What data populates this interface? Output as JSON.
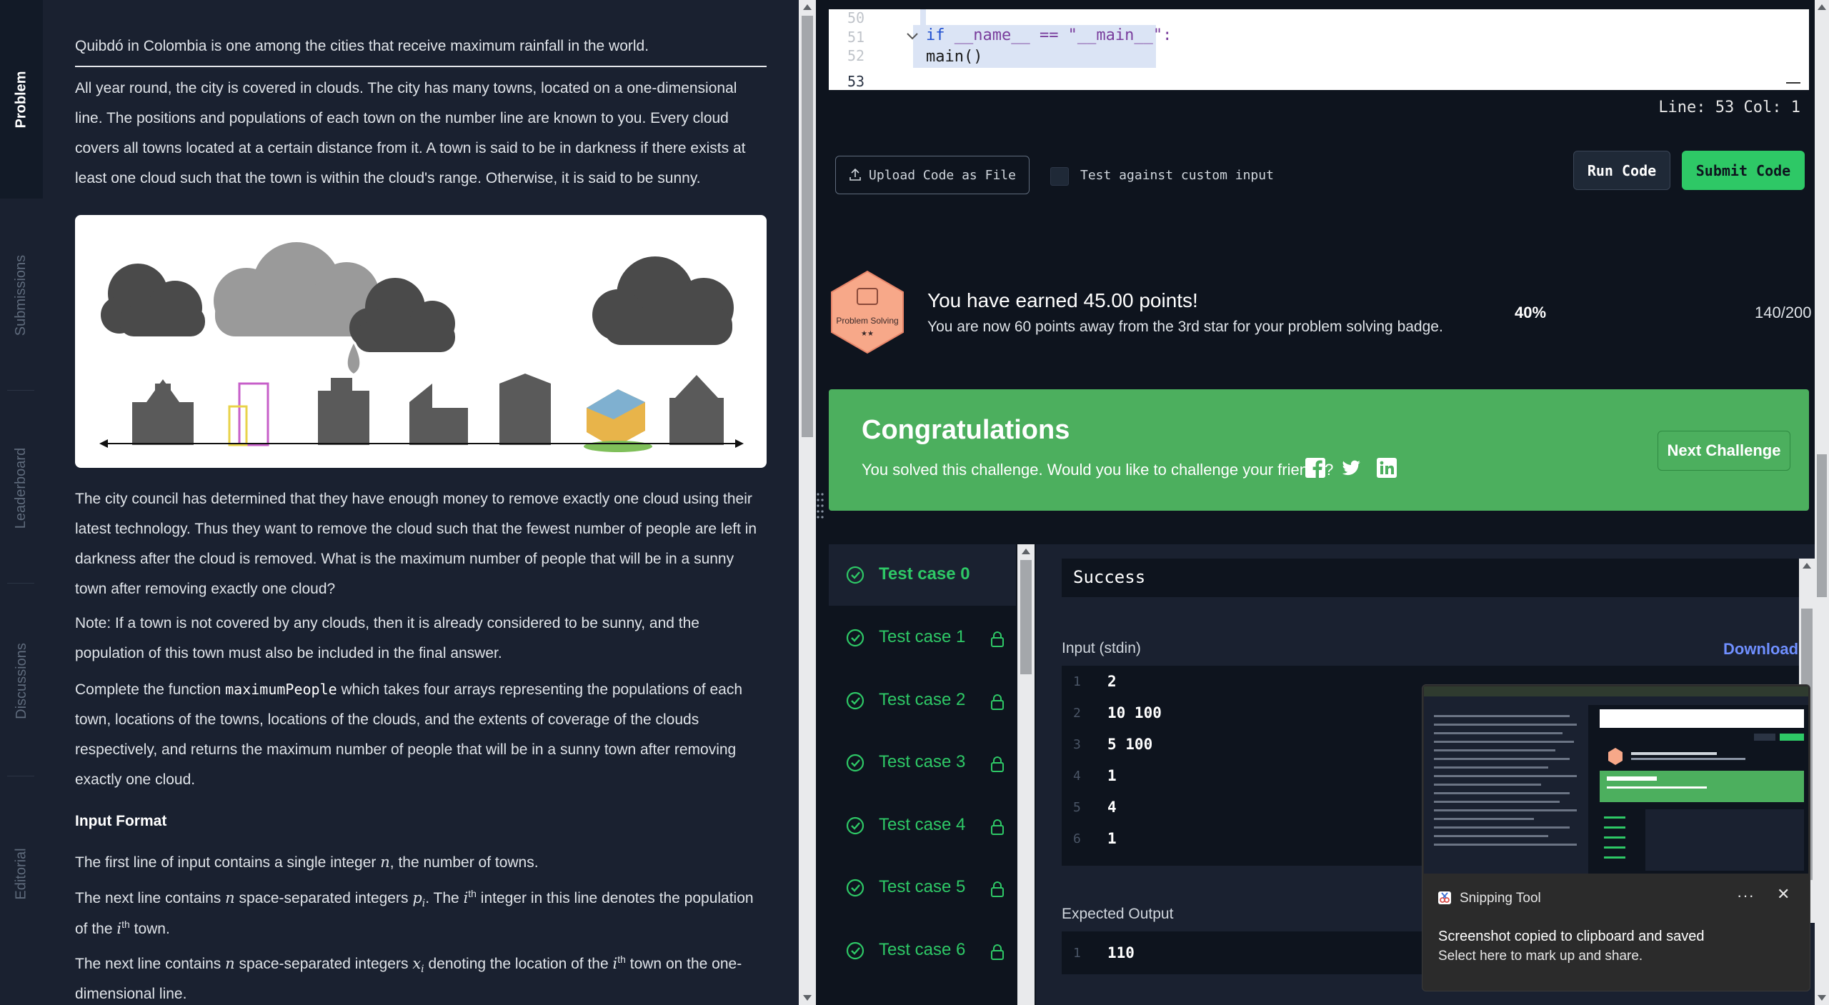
{
  "tabs": [
    "Problem",
    "Submissions",
    "Leaderboard",
    "Discussions",
    "Editorial"
  ],
  "problem": {
    "intro": "Quibdó in Colombia is one among the cities that receive maximum rainfall in the world.",
    "p1": "All year round, the city is covered in clouds. The city has many towns, located on a one-dimensional line. The positions and populations of each town on the number line are known to you. Every cloud covers all towns located at a certain distance from it. A town is said to be in darkness if there exists at least one cloud such that the town is within the cloud's range. Otherwise, it is said to be sunny.",
    "p2": "The city council has determined that they have enough money to remove exactly one cloud using their latest technology. Thus they want to remove the cloud such that the fewest number of people are left in darkness after the cloud is removed. What is the maximum number of people that will be in a sunny town after removing exactly one cloud?",
    "p3": "Note: If a town is not covered by any clouds, then it is already considered to be sunny, and the population of this town must also be included in the final answer.",
    "p4_pre": "Complete the function ",
    "p4_code": "maximumPeople",
    "p4_post": " which takes four arrays representing the populations of each town, locations of the towns, locations of the clouds, and the extents of coverage of the clouds respectively, and returns the maximum number of people that will be in a sunny town after removing exactly one cloud.",
    "input_format_title": "Input Format",
    "p5_pre": "The first line of input contains a single integer ",
    "p5_var": "n",
    "p5_post": ", the number of towns.",
    "p6_pre": "The next line contains ",
    "p6_var": "n",
    "p6_mid": " space-separated integers ",
    "p6_var2": "p",
    "p6_sub": "i",
    "p6_mid2": ". The ",
    "p6_var3": "i",
    "p6_sup": "th",
    "p6_mid3": " integer in this line denotes the population of the ",
    "p6_var4": "i",
    "p6_sup2": "th",
    "p6_post": " town.",
    "p7_pre": "The next line contains ",
    "p7_var": "n",
    "p7_mid": " space-separated integers ",
    "p7_var2": "x",
    "p7_sub": "i",
    "p7_mid2": " denoting the location of the ",
    "p7_var3": "i",
    "p7_sup": "th",
    "p7_post": " town on the one-dimensional line."
  },
  "editor": {
    "lines": [
      {
        "num": "50",
        "code": ""
      },
      {
        "num": "51",
        "code_kw": "if",
        "code_rest": " __name__ == \"__main__\":"
      },
      {
        "num": "52",
        "code": "    main()"
      },
      {
        "num": "53",
        "code": ""
      }
    ],
    "status": "Line: 53  Col: 1"
  },
  "actions": {
    "upload_label": "Upload Code as File",
    "custom_input_label": "Test against custom input",
    "run_label": "Run Code",
    "submit_label": "Submit Code"
  },
  "points": {
    "badge_name": "Problem Solving",
    "badge_stars": "★★",
    "title": "You have earned 45.00 points!",
    "subtitle": "You are now 60 points away from the 3rd star for your problem solving badge.",
    "percent": "40%",
    "progress": "140/200"
  },
  "congrats": {
    "title": "Congratulations",
    "subtitle": "You solved this challenge. Would you like to challenge your friends?",
    "next_label": "Next Challenge"
  },
  "test_cases": [
    {
      "label": "Test case 0",
      "locked": false
    },
    {
      "label": "Test case 1",
      "locked": true
    },
    {
      "label": "Test case 2",
      "locked": true
    },
    {
      "label": "Test case 3",
      "locked": true
    },
    {
      "label": "Test case 4",
      "locked": true
    },
    {
      "label": "Test case 5",
      "locked": true
    },
    {
      "label": "Test case 6",
      "locked": true
    }
  ],
  "output": {
    "result": "Success",
    "input_label": "Input (stdin)",
    "download_label": "Download",
    "input_rows": [
      {
        "n": "1",
        "v": "2"
      },
      {
        "n": "2",
        "v": "10 100"
      },
      {
        "n": "3",
        "v": "5 100"
      },
      {
        "n": "4",
        "v": "1"
      },
      {
        "n": "5",
        "v": "4"
      },
      {
        "n": "6",
        "v": "1"
      }
    ],
    "expected_label": "Expected Output",
    "expected_rows": [
      {
        "n": "1",
        "v": "110"
      }
    ]
  },
  "toast": {
    "app_name": "Snipping Tool",
    "more": "···",
    "close": "✕",
    "line1": "Screenshot copied to clipboard and saved",
    "line2": "Select here to mark up and share."
  },
  "colors": {
    "accent_green": "#2ec866",
    "banner_green": "#4caf5e",
    "link_blue": "#6f8fff",
    "bg_dark": "#0e141e",
    "panel": "#1a2130"
  }
}
